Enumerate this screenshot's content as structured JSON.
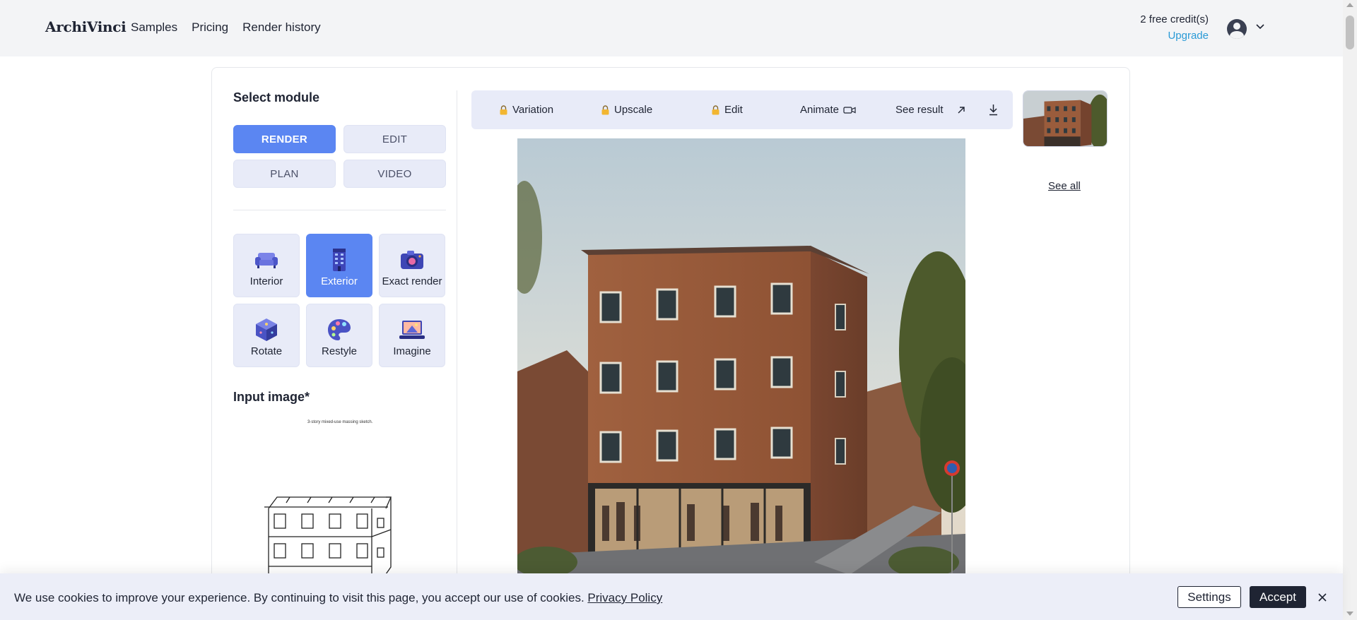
{
  "header": {
    "logo": "ArchiVinci",
    "nav": [
      "Samples",
      "Pricing",
      "Render history"
    ],
    "credits": "2 free credit(s)",
    "upgrade": "Upgrade"
  },
  "left": {
    "select_module_title": "Select module",
    "modules": [
      "RENDER",
      "EDIT",
      "PLAN",
      "VIDEO"
    ],
    "active_module": "RENDER",
    "types": [
      {
        "label": "Interior",
        "icon": "sofa-icon"
      },
      {
        "label": "Exterior",
        "icon": "building-icon"
      },
      {
        "label": "Exact render",
        "icon": "camera-icon"
      },
      {
        "label": "Rotate",
        "icon": "cube-icon"
      },
      {
        "label": "Restyle",
        "icon": "palette-icon"
      },
      {
        "label": "Imagine",
        "icon": "laptop-icon"
      }
    ],
    "active_type": "Exterior",
    "input_title": "Input image*",
    "sketch_caption": "3-story mixed-use massing sketch."
  },
  "toolbar": {
    "variation": "Variation",
    "upscale": "Upscale",
    "edit": "Edit",
    "animate": "Animate",
    "see_result": "See result"
  },
  "sidebar": {
    "see_all": "See all"
  },
  "cookie": {
    "text": "We use cookies to improve your experience. By continuing to visit this page, you accept our use of cookies.",
    "policy_link": "Privacy Policy",
    "settings": "Settings",
    "accept": "Accept"
  },
  "colors": {
    "accent": "#5b86f2",
    "tile_bg": "#e8ebf8",
    "link": "#2a9ad6",
    "dark": "#1f2433"
  }
}
